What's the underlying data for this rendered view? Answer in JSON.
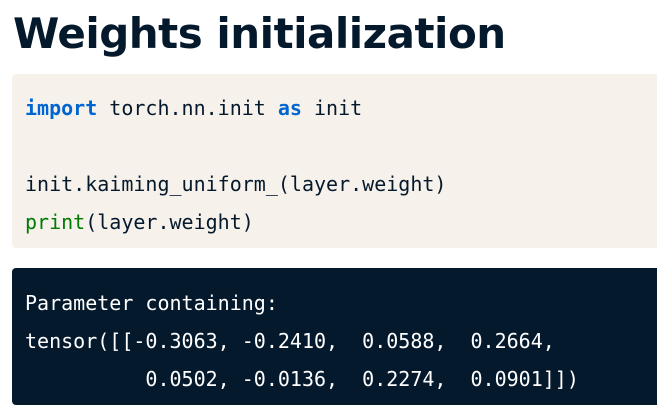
{
  "title": "Weights initialization",
  "code": {
    "line1": {
      "kw_import": "import",
      "module": " torch.nn.init ",
      "kw_as": "as",
      "alias": " init"
    },
    "line2": "",
    "line3": "init.kaiming_uniform_(layer.weight)",
    "line4": {
      "fn": "print",
      "args": "(layer.weight)"
    }
  },
  "output": {
    "lines": [
      "Parameter containing:",
      "tensor([[-0.3063, -0.2410,  0.0588,  0.2664,",
      "          0.0502, -0.0136,  0.2274,  0.0901]])"
    ]
  },
  "colors": {
    "title": "#05192d",
    "code_bg": "#f6f1ea",
    "output_bg": "#05192d",
    "keyword": "#0065d1",
    "builtin": "#007a00"
  }
}
